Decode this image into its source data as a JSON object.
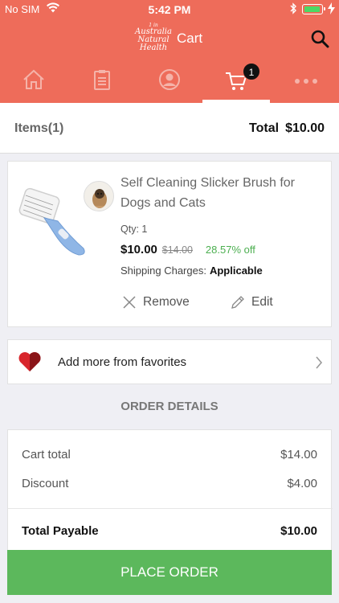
{
  "status_bar": {
    "carrier": "No SIM",
    "time": "5:42 PM"
  },
  "header": {
    "logo_top": "1 in",
    "logo_text": "Australia Natural Health",
    "title": "Cart"
  },
  "tabs": [
    {
      "name": "home",
      "icon": "home-icon"
    },
    {
      "name": "orders",
      "icon": "clipboard-icon"
    },
    {
      "name": "account",
      "icon": "user-icon"
    },
    {
      "name": "cart",
      "icon": "cart-icon",
      "badge": "1",
      "active": true
    },
    {
      "name": "more",
      "icon": "more-icon"
    }
  ],
  "summary": {
    "items_label": "Items",
    "items_count": "(1)",
    "total_label": "Total",
    "total_value": "$10.00"
  },
  "product": {
    "name": "Self Cleaning Slicker Brush for Dogs and Cats",
    "qty": "Qty: 1",
    "price": "$10.00",
    "mrp": "$14.00",
    "discount": "28.57% off",
    "shipping_label": "Shipping Charges:",
    "shipping_value": "Applicable",
    "remove_label": "Remove",
    "edit_label": "Edit"
  },
  "favorites": {
    "label": "Add more from favorites"
  },
  "order_details": {
    "heading": "ORDER DETAILS",
    "cart_total_label": "Cart total",
    "cart_total_value": "$14.00",
    "discount_label": "Discount",
    "discount_value": "$4.00",
    "payable_label": "Total Payable",
    "payable_value": "$10.00"
  },
  "cta": {
    "label": "PLACE ORDER"
  },
  "colors": {
    "brand": "#ee6c5a",
    "accent_green": "#5cb85c",
    "discount_green": "#4caf50"
  }
}
